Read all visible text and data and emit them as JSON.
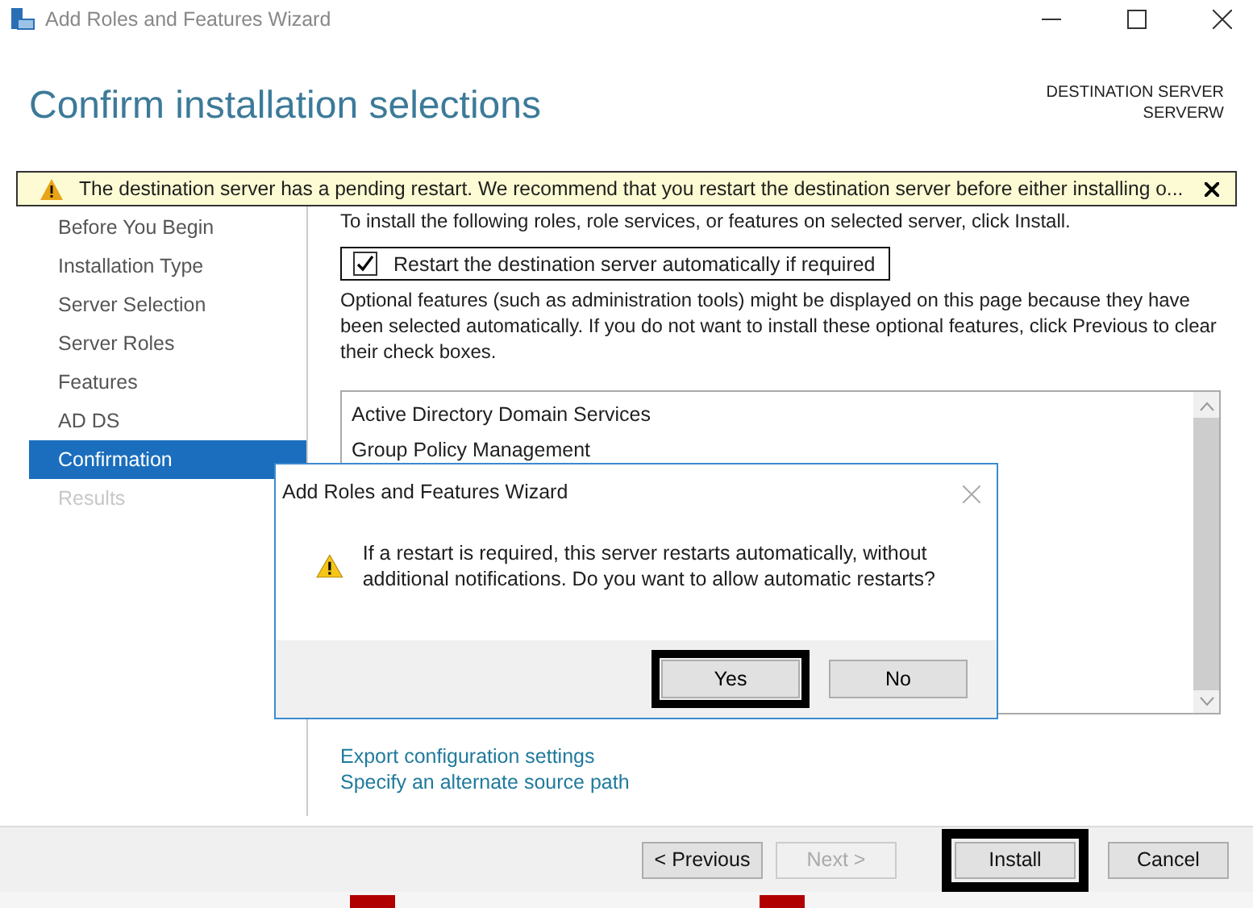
{
  "window": {
    "title": "Add Roles and Features Wizard"
  },
  "header": {
    "title": "Confirm installation selections",
    "destination_label": "DESTINATION SERVER",
    "destination_server": "SERVERW"
  },
  "banner": {
    "message": "The destination server has a pending restart. We recommend that you restart the destination server before either installing o..."
  },
  "nav": [
    {
      "label": "Before You Begin",
      "selected": false,
      "disabled": false
    },
    {
      "label": "Installation Type",
      "selected": false,
      "disabled": false
    },
    {
      "label": "Server Selection",
      "selected": false,
      "disabled": false
    },
    {
      "label": "Server Roles",
      "selected": false,
      "disabled": false
    },
    {
      "label": "Features",
      "selected": false,
      "disabled": false
    },
    {
      "label": "AD DS",
      "selected": false,
      "disabled": false
    },
    {
      "label": "Confirmation",
      "selected": true,
      "disabled": false
    },
    {
      "label": "Results",
      "selected": false,
      "disabled": true
    }
  ],
  "content": {
    "intro": "To install the following roles, role services, or features on selected server, click Install.",
    "restart_checkbox": {
      "label": "Restart the destination server automatically if required",
      "checked": true,
      "focused": true
    },
    "note": "Optional features (such as administration tools) might be displayed on this page because they have been selected automatically. If you do not want to install these optional features, click Previous to clear their check boxes.",
    "features": [
      "Active Directory Domain Services",
      "Group Policy Management"
    ],
    "links": [
      "Export configuration settings",
      "Specify an alternate source path"
    ]
  },
  "dialog": {
    "title": "Add Roles and Features Wizard",
    "message": "If a restart is required, this server restarts automatically, without additional notifications. Do you want to allow automatic restarts?",
    "buttons": [
      {
        "label": "Yes",
        "highlighted": true
      },
      {
        "label": "No",
        "highlighted": false
      }
    ]
  },
  "footer": {
    "buttons": [
      {
        "label": "< Previous",
        "disabled": false,
        "highlighted": false
      },
      {
        "label": "Next >",
        "disabled": true,
        "highlighted": false
      },
      {
        "label": "Install",
        "disabled": false,
        "highlighted": true
      },
      {
        "label": "Cancel",
        "disabled": false,
        "highlighted": false
      }
    ]
  }
}
